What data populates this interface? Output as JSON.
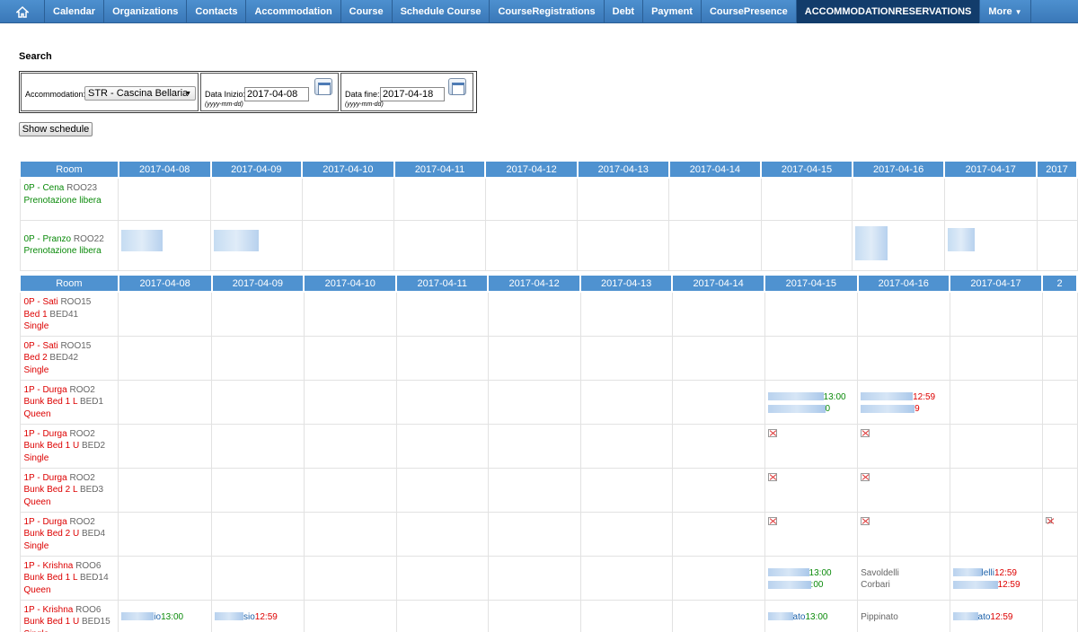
{
  "nav": {
    "items": [
      "Calendar",
      "Organizations",
      "Contacts",
      "Accommodation",
      "Course",
      "Schedule Course",
      "CourseRegistrations",
      "Debt",
      "Payment",
      "CoursePresence",
      "ACCOMMODATIONRESERVATIONS"
    ],
    "more": "More"
  },
  "search": {
    "title": "Search",
    "accommodation_label": "Accommodation:",
    "accommodation_value": "STR - Cascina Bellaria",
    "start_label": "Data Inizio:",
    "start_value": "2017-04-08",
    "end_label": "Data fine:",
    "end_value": "2017-04-18",
    "date_hint": "(yyyy-mm-dd)",
    "show_button": "Show schedule"
  },
  "table1": {
    "room_header": "Room",
    "dates": [
      "2017-04-08",
      "2017-04-09",
      "2017-04-10",
      "2017-04-11",
      "2017-04-12",
      "2017-04-13",
      "2017-04-14",
      "2017-04-15",
      "2017-04-16",
      "2017-04-17",
      "2017"
    ],
    "rows": [
      {
        "name": "0P - Cena",
        "code": "ROO23",
        "status": "Prenotazione libera"
      },
      {
        "name": "0P - Pranzo",
        "code": "ROO22",
        "status": "Prenotazione libera"
      }
    ]
  },
  "table2": {
    "room_header": "Room",
    "dates": [
      "2017-04-08",
      "2017-04-09",
      "2017-04-10",
      "2017-04-11",
      "2017-04-12",
      "2017-04-13",
      "2017-04-14",
      "2017-04-15",
      "2017-04-16",
      "2017-04-17",
      "2"
    ],
    "rows": [
      {
        "name": "0P - Sati",
        "code": "ROO15",
        "bed": "Bed 1",
        "bedcode": "BED41",
        "type": "Single"
      },
      {
        "name": "0P - Sati",
        "code": "ROO15",
        "bed": "Bed 2",
        "bedcode": "BED42",
        "type": "Single"
      },
      {
        "name": "1P - Durga",
        "code": "ROO2",
        "bed": "Bunk Bed 1 L",
        "bedcode": "BED1",
        "type": "Queen"
      },
      {
        "name": "1P - Durga",
        "code": "ROO2",
        "bed": "Bunk Bed 1 U",
        "bedcode": "BED2",
        "type": "Single"
      },
      {
        "name": "1P - Durga",
        "code": "ROO2",
        "bed": "Bunk Bed 2 L",
        "bedcode": "BED3",
        "type": "Queen"
      },
      {
        "name": "1P - Durga",
        "code": "ROO2",
        "bed": "Bunk Bed 2 U",
        "bedcode": "BED4",
        "type": "Single"
      },
      {
        "name": "1P - Krishna",
        "code": "ROO6",
        "bed": "Bunk Bed 1 L",
        "bedcode": "BED14",
        "type": "Queen"
      },
      {
        "name": "1P - Krishna",
        "code": "ROO6",
        "bed": "Bunk Bed 1 U",
        "bedcode": "BED15",
        "type": "Single"
      }
    ],
    "entries": {
      "durga_b1l_d15": {
        "t1": "13:00",
        "t2": "0"
      },
      "durga_b1l_d16": {
        "t1": "12:59",
        "t2": "9"
      },
      "krishna_b1l_d15": {
        "t1": "13:00",
        "t2": ":00"
      },
      "krishna_b1l_d16": {
        "l1": "Savoldelli",
        "l2": "Corbari"
      },
      "krishna_b1l_d17": {
        "p1": "lelli",
        "t1": "12:59",
        "t2": "12:59"
      },
      "krishna_b1u_d08": {
        "p": "io",
        "t": "13:00"
      },
      "krishna_b1u_d09": {
        "p": "sio",
        "t": "12:59"
      },
      "krishna_b1u_d15": {
        "p": "ato",
        "t": "13:00"
      },
      "krishna_b1u_d16": {
        "l": "Pippinato"
      },
      "krishna_b1u_d17": {
        "p": "ato",
        "t": "12:59"
      }
    }
  }
}
